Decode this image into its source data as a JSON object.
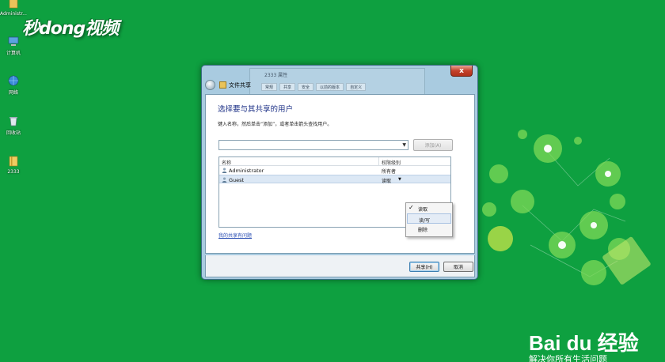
{
  "desktop": {
    "icons": [
      {
        "label": "Administr..."
      },
      {
        "label": "计算机"
      },
      {
        "label": "网络"
      },
      {
        "label": "回收站"
      },
      {
        "label": "2333"
      }
    ],
    "watermark": "秒dong视频"
  },
  "dialog": {
    "title": "文件共享",
    "close_label": "x",
    "background_window": {
      "title": "2333 属性",
      "tabs": [
        "常规",
        "共享",
        "安全",
        "以前的版本",
        "自定义"
      ]
    },
    "heading": "选择要与其共享的用户",
    "instruction": "键入名称，然后单击“添加”，或者单击箭头查找用户。",
    "add_button": "添加(A)",
    "list": {
      "columns": {
        "name": "名称",
        "permission": "权限级别"
      },
      "rows": [
        {
          "name": "Administrator",
          "permission": "所有者"
        },
        {
          "name": "Guest",
          "permission": "读取"
        }
      ]
    },
    "permission_menu": {
      "items": [
        {
          "label": "读取",
          "checked": true
        },
        {
          "label": "读/写",
          "checked": false
        },
        {
          "label": "删除",
          "checked": false
        }
      ]
    },
    "help_link": "我的共享有问题",
    "share_button": "共享(H)",
    "cancel_button": "取消"
  },
  "branding": {
    "logo_text": "Bai du 经验",
    "tagline": "解决你所有生活问题"
  },
  "colors": {
    "desktop_bg": "#0ea040",
    "heading_blue": "#1e3287"
  }
}
